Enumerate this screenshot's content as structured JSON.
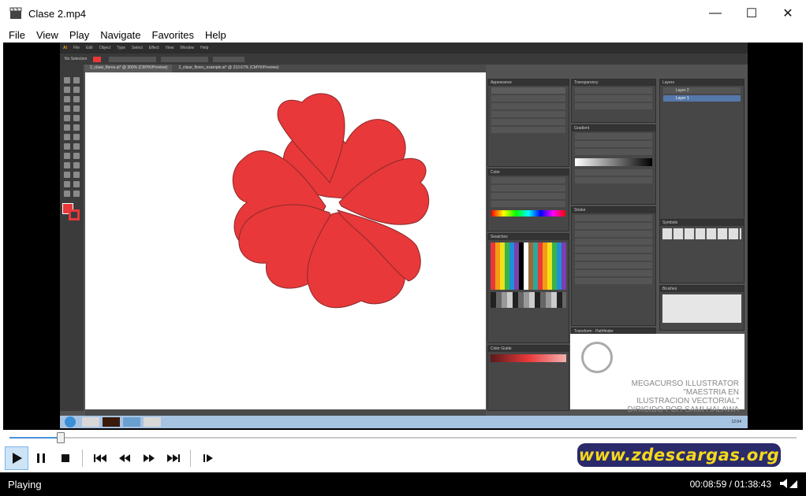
{
  "window": {
    "title": "Clase 2.mp4",
    "minimize_label": "—",
    "maximize_label": "☐",
    "close_label": "✕"
  },
  "menu": [
    "File",
    "View",
    "Play",
    "Navigate",
    "Favorites",
    "Help"
  ],
  "video": {
    "app_menu": [
      "File",
      "Edit",
      "Object",
      "Type",
      "Select",
      "Effect",
      "View",
      "Window",
      "Help"
    ],
    "doc_tabs": [
      "2_clase_flores.ai* @ 300% (CMYK/Preview)",
      "2_clase_flores_example.ai* @ 210.67% (CMYK/Preview)"
    ],
    "control_label": "No Selection",
    "panels": [
      "Appearance",
      "Transparency",
      "Layers",
      "Gradient",
      "Color",
      "Stroke",
      "Swatches",
      "Symbols",
      "Color Guide",
      "Brushes",
      "Transform",
      "Pathfinder"
    ],
    "layers": [
      "Layer 2",
      "Layer 1"
    ],
    "watermark_lines": [
      "MEGACURSO ILLUSTRATOR",
      "\"MAESTRIA EN",
      "ILUSTRACION VECTORIAL\"",
      "DIRIGIDO POR SAMI HALAWA"
    ],
    "flower_color": "#e8383a",
    "taskbar_clock": "12:04"
  },
  "seek": {
    "progress": 0.065
  },
  "controls": {
    "play_icon": "play-icon",
    "pause_icon": "pause-icon",
    "stop_icon": "stop-icon",
    "prev_icon": "skip-back-icon",
    "rewind_icon": "rewind-icon",
    "forward_icon": "fast-forward-icon",
    "next_icon": "skip-forward-icon",
    "frame_icon": "frame-step-icon"
  },
  "site_banner": "www.zdescargas.org",
  "status": {
    "text": "Playing",
    "time": "00:08:59 / 01:38:43"
  },
  "colors": {
    "accent": "#4a90d9",
    "banner_bg": "#2b2a6b",
    "banner_text": "#f3d81c"
  }
}
